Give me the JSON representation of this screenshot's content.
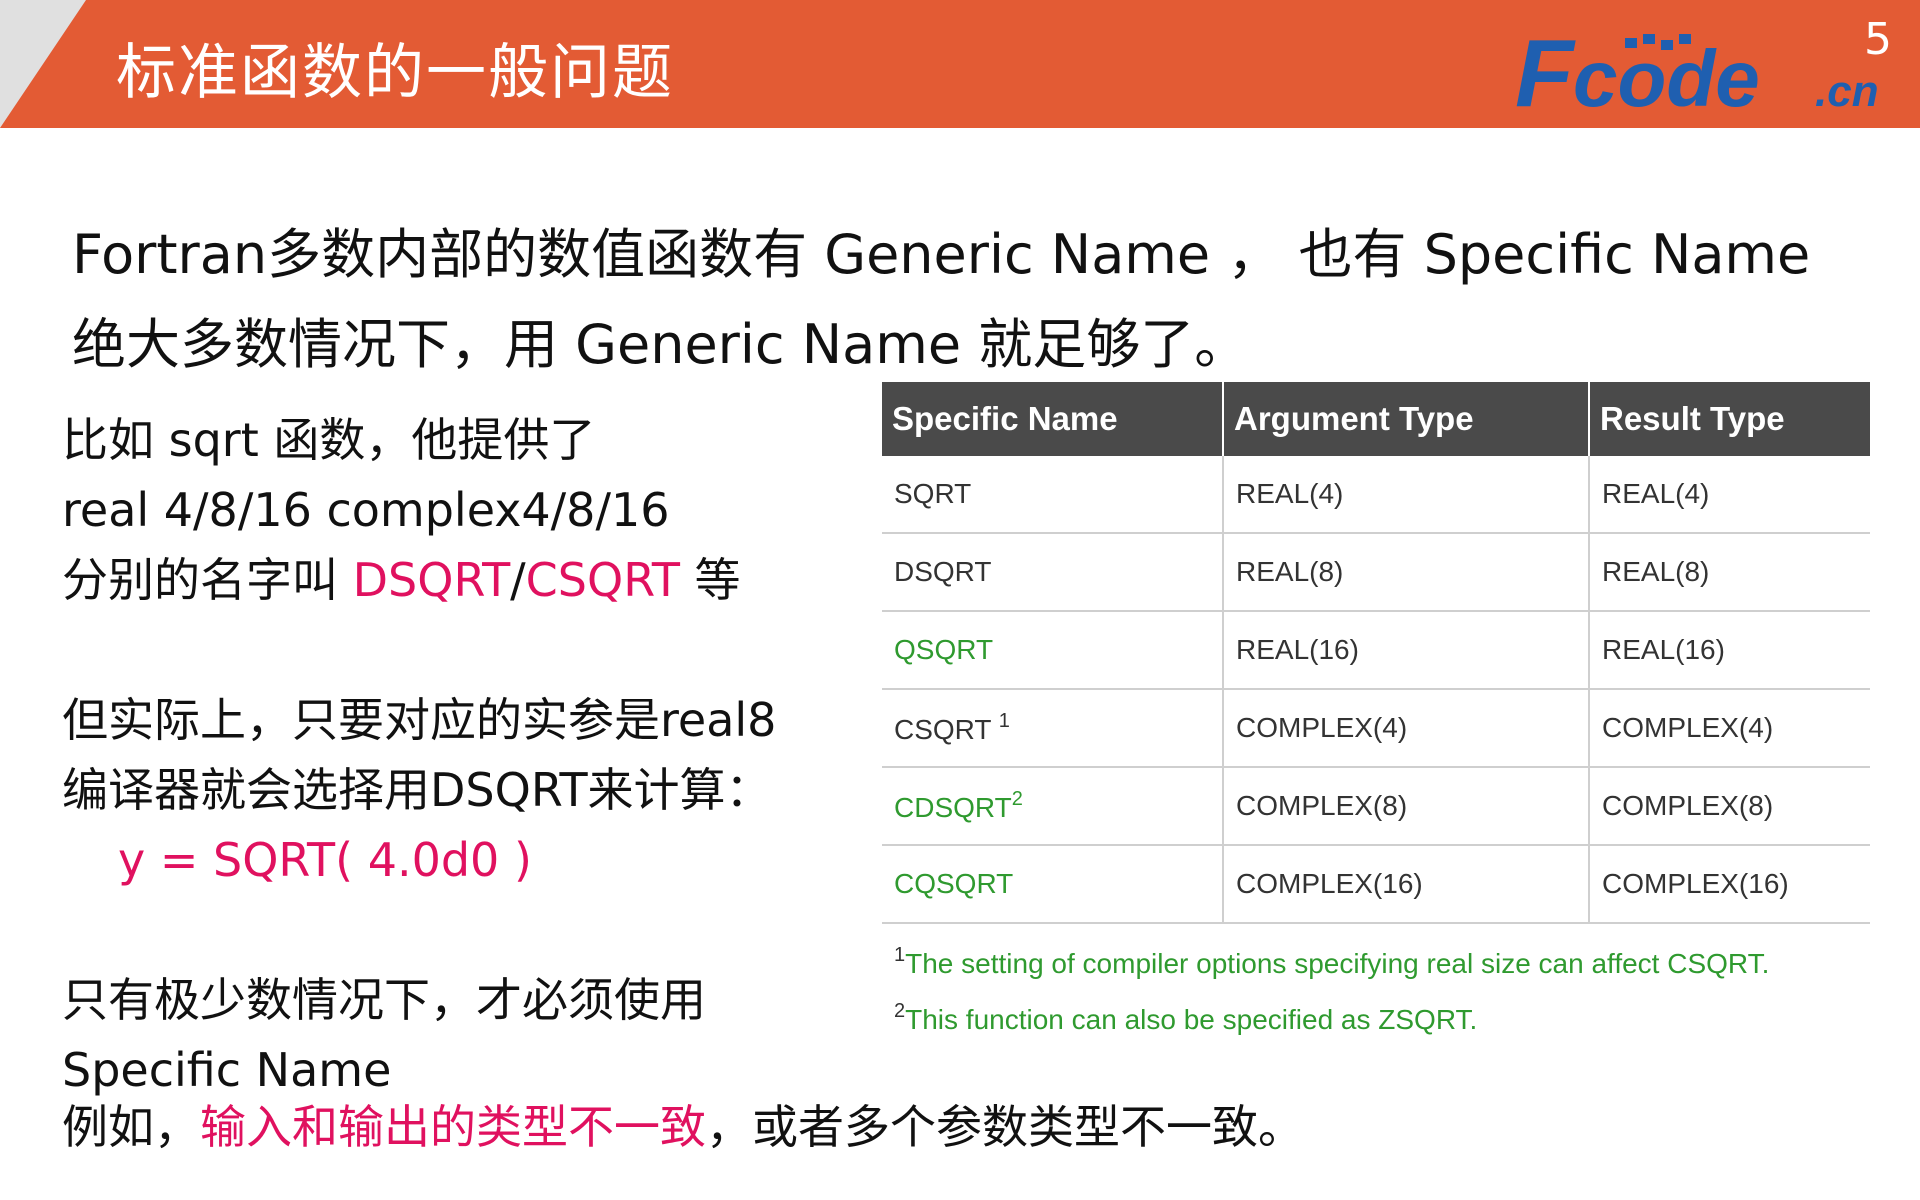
{
  "header": {
    "title": "标准函数的一般问题",
    "page_number": "5",
    "logo_text": "Fcode.cn",
    "background_color": "#e35b34"
  },
  "intro": {
    "line1": "Fortran多数内部的数值函数有 Generic Name ， 也有 Specific Name",
    "line2": "绝大多数情况下，用 Generic Name 就足够了。"
  },
  "left": {
    "line1": "比如 sqrt 函数，他提供了",
    "line2": "real 4/8/16      complex4/8/16",
    "line3_pre": "分别的名字叫 ",
    "line3_a": "DSQRT",
    "line3_sep": "/",
    "line3_b": "CSQRT",
    "line3_post": " 等",
    "line4": "但实际上，只要对应的实参是real8",
    "line5": "编译器就会选择用DSQRT来计算：",
    "code": "y = SQRT( 4.0d0 )",
    "line6": "只有极少数情况下，才必须使用",
    "line7": "Specific Name",
    "line8_pre": "例如，",
    "line8_highlight": "输入和输出的类型不一致",
    "line8_post": "，或者多个参数类型不一致。",
    "highlight_color": "#e0115f"
  },
  "table": {
    "headers": [
      "Specific Name",
      "Argument Type",
      "Result Type"
    ],
    "rows": [
      {
        "name": "SQRT",
        "sup": "",
        "arg": "REAL(4)",
        "result": "REAL(4)",
        "green": false
      },
      {
        "name": "DSQRT",
        "sup": "",
        "arg": "REAL(8)",
        "result": "REAL(8)",
        "green": false
      },
      {
        "name": "QSQRT",
        "sup": "",
        "arg": "REAL(16)",
        "result": "REAL(16)",
        "green": true
      },
      {
        "name": "CSQRT ",
        "sup": "1",
        "arg": "COMPLEX(4)",
        "result": "COMPLEX(4)",
        "green": false
      },
      {
        "name": "CDSQRT",
        "sup": "2",
        "arg": "COMPLEX(8)",
        "result": "COMPLEX(8)",
        "green": true
      },
      {
        "name": "CQSQRT",
        "sup": "",
        "arg": "COMPLEX(16)",
        "result": "COMPLEX(16)",
        "green": true
      }
    ],
    "header_color": "#4a4a4a",
    "green_color": "#2f9a2f",
    "footnotes": [
      {
        "mark": "1",
        "text": "The setting of compiler options specifying real size can affect CSQRT."
      },
      {
        "mark": "2",
        "text": "This function can also be specified as ZSQRT."
      }
    ]
  }
}
